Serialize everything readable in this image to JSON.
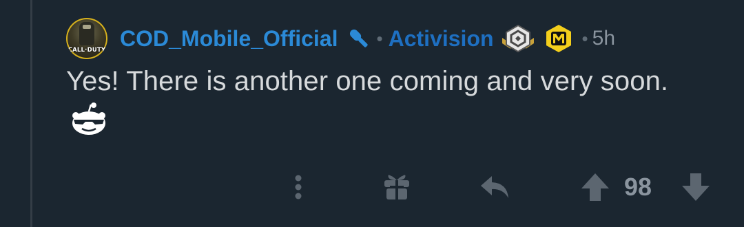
{
  "comment": {
    "author": "COD_Mobile_Official",
    "avatar_text": "CALL·DUTY",
    "flair": "Activision",
    "separator": "•",
    "time": "5h",
    "body": "Yes! There is another one coming and very soon.",
    "score": "98"
  },
  "icons": {
    "mic": "microphone-icon",
    "award1": "silver-emblem-award-icon",
    "award2": "cod-mobile-m-award-icon",
    "snoo": "sunglasses-snoo-emote",
    "more": "vertical-ellipsis-icon",
    "gift": "gift-icon",
    "reply": "reply-arrow-icon",
    "upvote": "upvote-arrow-icon",
    "downvote": "downvote-arrow-icon"
  },
  "colors": {
    "background": "#1b2630",
    "username": "#2b8ad7",
    "flair": "#1e6fc1",
    "body_text": "#d7dadc",
    "muted": "#8a949e",
    "action_icon": "#5c6670"
  }
}
